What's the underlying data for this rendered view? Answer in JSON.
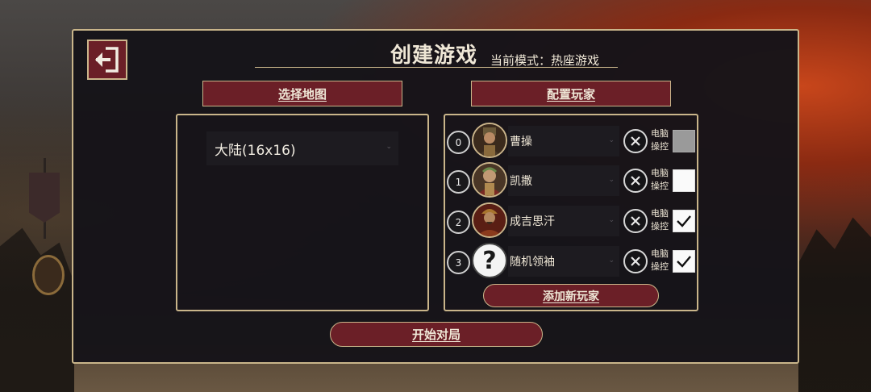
{
  "window": {
    "title": "创建游戏",
    "mode_text": "当前模式：热座游戏"
  },
  "back_button": {
    "icon": "exit-door-icon"
  },
  "map_section": {
    "header": "选择地图",
    "selected_map": "大陆(16x16)"
  },
  "players_section": {
    "header": "配置玩家",
    "players": [
      {
        "index": "0",
        "leader": "曹操",
        "portrait": "caocao-portrait",
        "ai_label": "电脑操控",
        "ai_controlled": true,
        "check_style": "disabled"
      },
      {
        "index": "1",
        "leader": "凯撒",
        "portrait": "caesar-portrait",
        "ai_label": "电脑操控",
        "ai_controlled": false,
        "check_style": "empty"
      },
      {
        "index": "2",
        "leader": "成吉思汗",
        "portrait": "genghis-portrait",
        "ai_label": "电脑操控",
        "ai_controlled": true,
        "check_style": "checked"
      },
      {
        "index": "3",
        "leader": "随机领袖",
        "portrait": "random-question-icon",
        "ai_label": "电脑操控",
        "ai_controlled": true,
        "check_style": "checked"
      }
    ],
    "add_player_button": "添加新玩家"
  },
  "start_button": "开始对局",
  "colors": {
    "accent_red": "#6b1f27",
    "gold_border": "#c9b58a",
    "panel_bg": "#16141a"
  }
}
